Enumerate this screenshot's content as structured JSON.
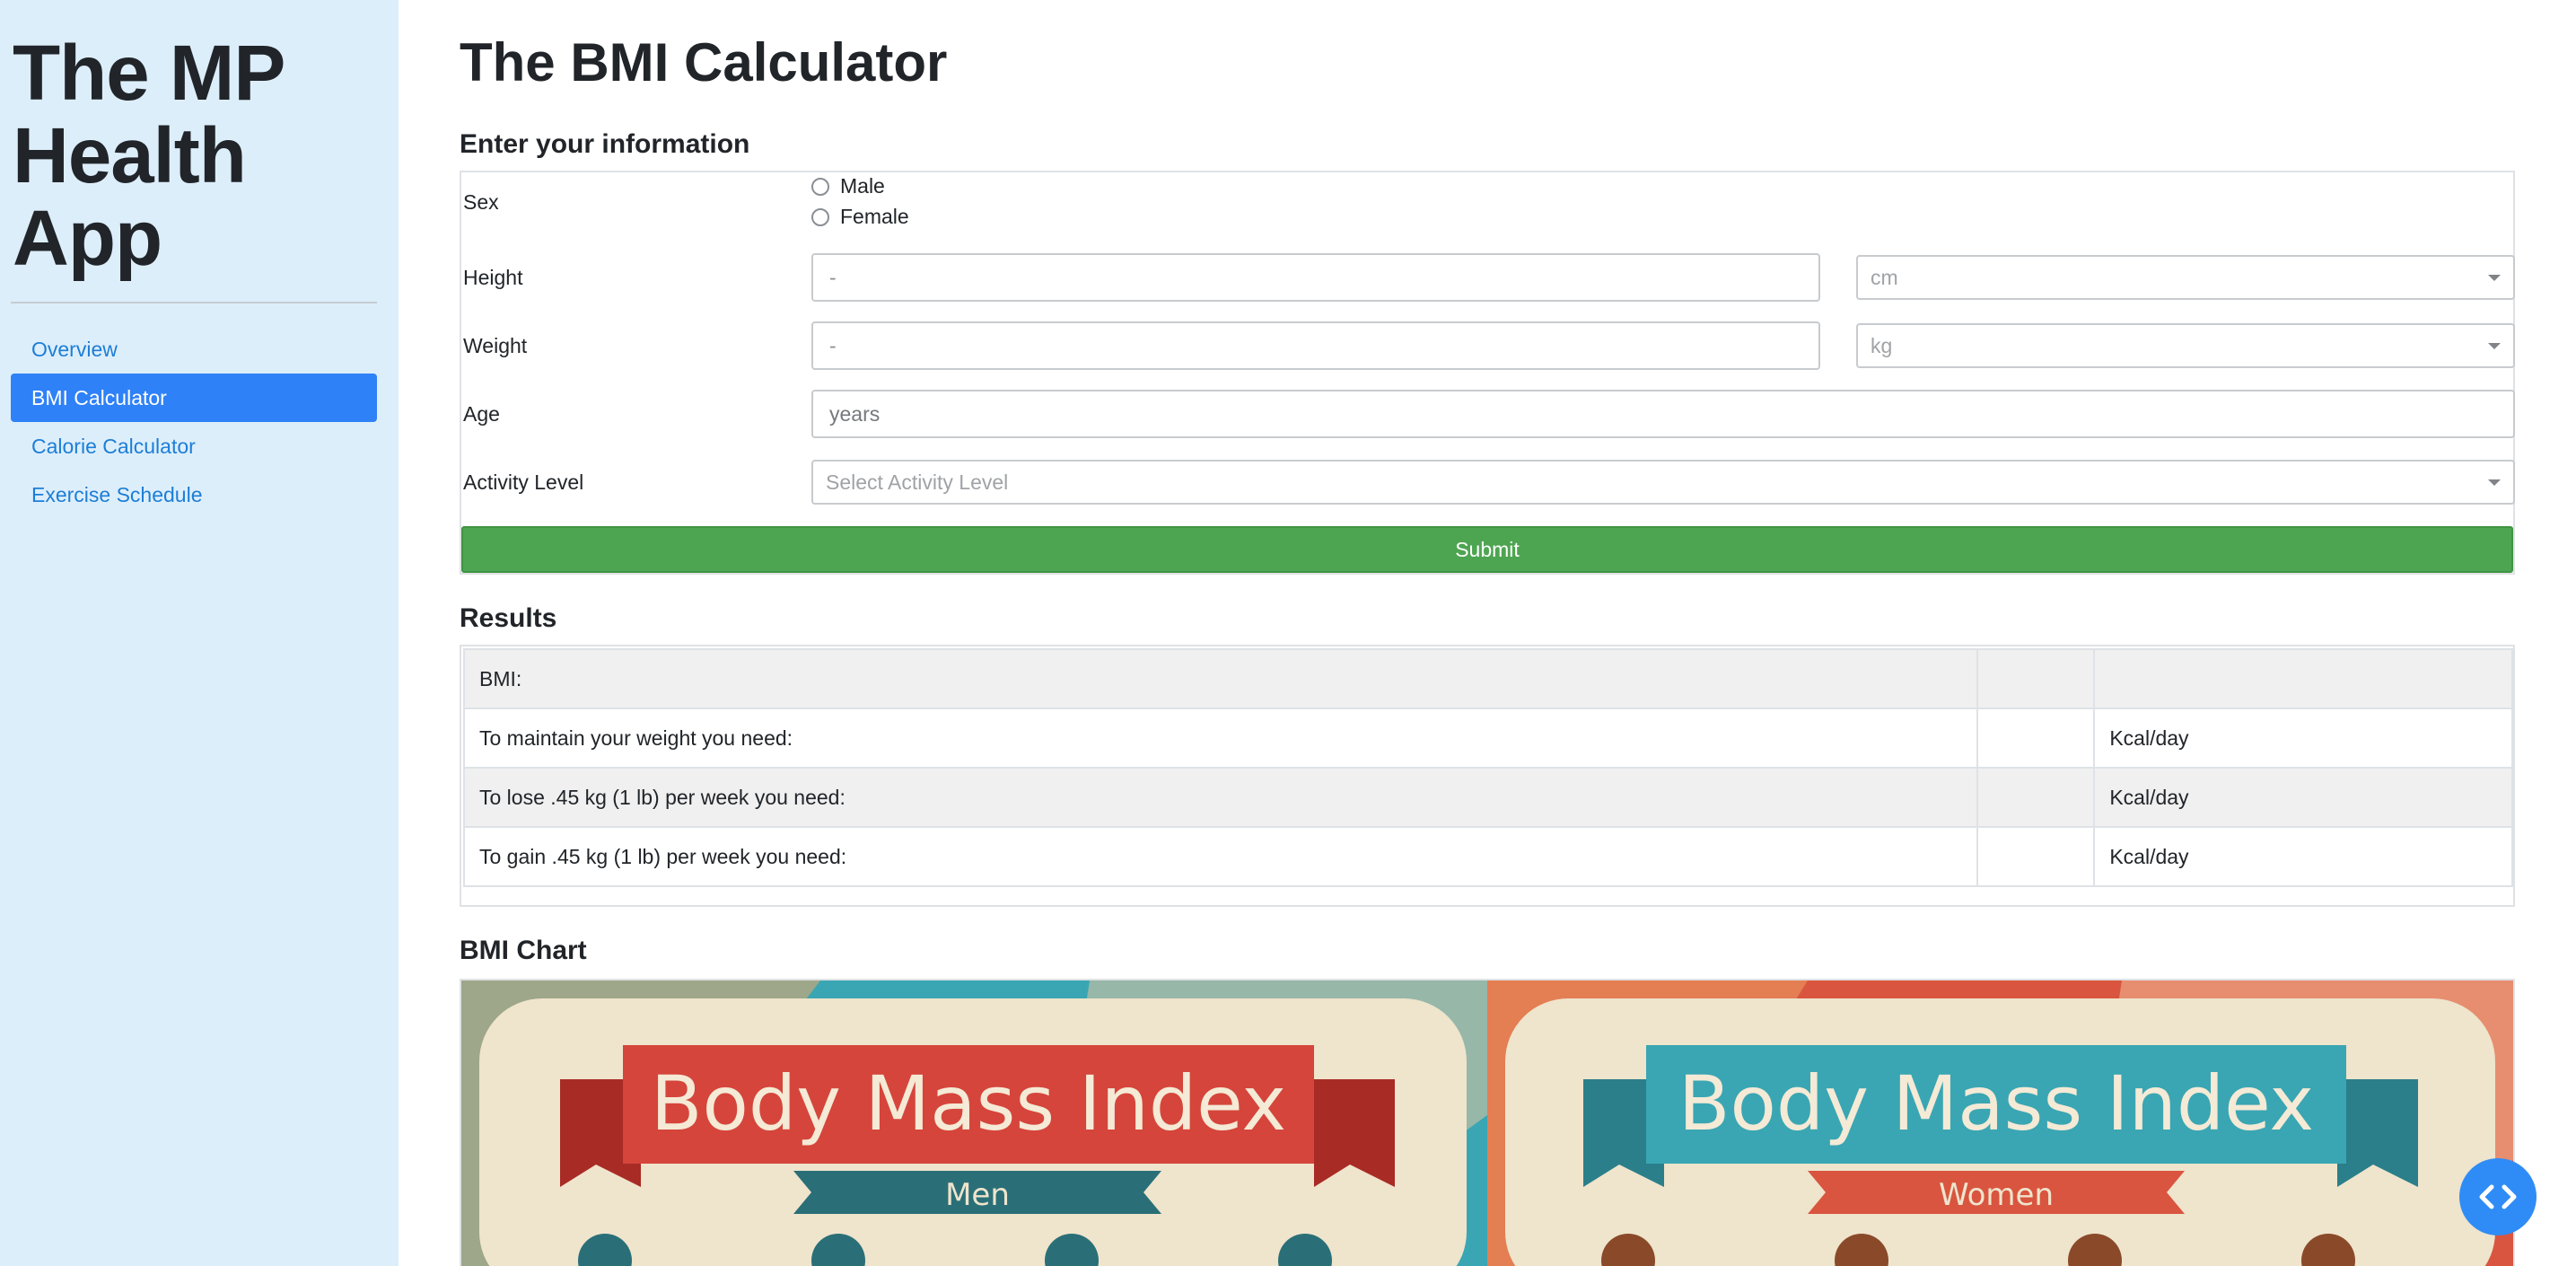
{
  "sidebar": {
    "app_title_lines": [
      "The MP",
      "Health",
      "App"
    ],
    "nav": [
      {
        "label": "Overview",
        "active": false
      },
      {
        "label": "BMI Calculator",
        "active": true
      },
      {
        "label": "Calorie Calculator",
        "active": false
      },
      {
        "label": "Exercise Schedule",
        "active": false
      }
    ]
  },
  "main": {
    "title": "The BMI Calculator",
    "form": {
      "heading": "Enter your information",
      "sex_label": "Sex",
      "sex_options": [
        "Male",
        "Female"
      ],
      "height_label": "Height",
      "height_placeholder": "-",
      "height_unit": "cm",
      "weight_label": "Weight",
      "weight_placeholder": "-",
      "weight_unit": "kg",
      "age_label": "Age",
      "age_placeholder": "years",
      "activity_label": "Activity Level",
      "activity_placeholder": "Select Activity Level",
      "submit_label": "Submit"
    },
    "results": {
      "heading": "Results",
      "rows": [
        {
          "label": "BMI:",
          "value": "",
          "unit": ""
        },
        {
          "label": "To maintain your weight you need:",
          "value": "",
          "unit": "Kcal/day"
        },
        {
          "label": "To lose .45 kg (1 lb) per week you need:",
          "value": "",
          "unit": "Kcal/day"
        },
        {
          "label": "To gain .45 kg (1 lb) per week you need:",
          "value": "",
          "unit": "Kcal/day"
        }
      ]
    },
    "chart": {
      "heading": "BMI Chart",
      "panels": [
        {
          "title": "Body Mass Index",
          "subtitle": "Men"
        },
        {
          "title": "Body Mass Index",
          "subtitle": "Women"
        }
      ]
    }
  },
  "colors": {
    "sidebar_bg": "#ddeefb",
    "accent": "#2f81f7",
    "link": "#1c7ed6",
    "submit_green": "#4ea551"
  },
  "icons": [
    "chevron-down-icon",
    "code-icon"
  ]
}
